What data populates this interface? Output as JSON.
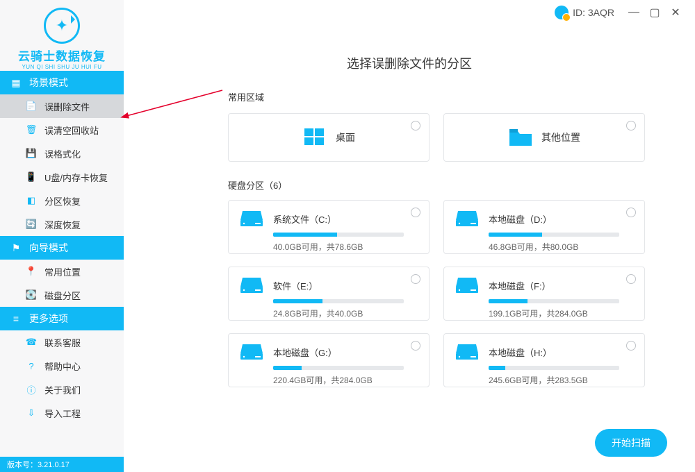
{
  "brand": {
    "name": "云骑士数据恢复",
    "sub": "YUN QI SHI SHU JU HUI FU"
  },
  "titlebar": {
    "id_label": "ID: 3AQR"
  },
  "sidebar": {
    "sections": [
      {
        "title": "场景模式",
        "items": [
          {
            "label": "误删除文件",
            "active": true,
            "icon": "file-recover-icon"
          },
          {
            "label": "误清空回收站",
            "icon": "trash-icon"
          },
          {
            "label": "误格式化",
            "icon": "save-icon"
          },
          {
            "label": "U盘/内存卡恢复",
            "icon": "sdcard-icon"
          },
          {
            "label": "分区恢复",
            "icon": "partition-icon"
          },
          {
            "label": "深度恢复",
            "icon": "deep-icon"
          }
        ]
      },
      {
        "title": "向导模式",
        "items": [
          {
            "label": "常用位置",
            "icon": "location-icon"
          },
          {
            "label": "磁盘分区",
            "icon": "disk-icon"
          }
        ]
      },
      {
        "title": "更多选项",
        "items": [
          {
            "label": "联系客服",
            "icon": "phone-icon"
          },
          {
            "label": "帮助中心",
            "icon": "help-icon"
          },
          {
            "label": "关于我们",
            "icon": "info-icon"
          },
          {
            "label": "导入工程",
            "icon": "import-icon"
          }
        ]
      }
    ]
  },
  "version": "版本号：3.21.0.17",
  "main": {
    "title": "选择误删除文件的分区",
    "common_area_label": "常用区域",
    "common_cards": [
      {
        "label": "桌面",
        "icon": "windows"
      },
      {
        "label": "其他位置",
        "icon": "folder"
      }
    ],
    "partition_label": "硬盘分区（6）",
    "partitions": [
      {
        "name": "系统文件（C:）",
        "free": "40.0GB可用，共78.6GB",
        "fill": 49
      },
      {
        "name": "本地磁盘（D:）",
        "free": "46.8GB可用，共80.0GB",
        "fill": 41
      },
      {
        "name": "软件（E:）",
        "free": "24.8GB可用，共40.0GB",
        "fill": 38
      },
      {
        "name": "本地磁盘（F:）",
        "free": "199.1GB可用，共284.0GB",
        "fill": 30
      },
      {
        "name": "本地磁盘（G:）",
        "free": "220.4GB可用，共284.0GB",
        "fill": 22
      },
      {
        "name": "本地磁盘（H:）",
        "free": "245.6GB可用，共283.5GB",
        "fill": 13
      }
    ],
    "scan_button": "开始扫描"
  }
}
